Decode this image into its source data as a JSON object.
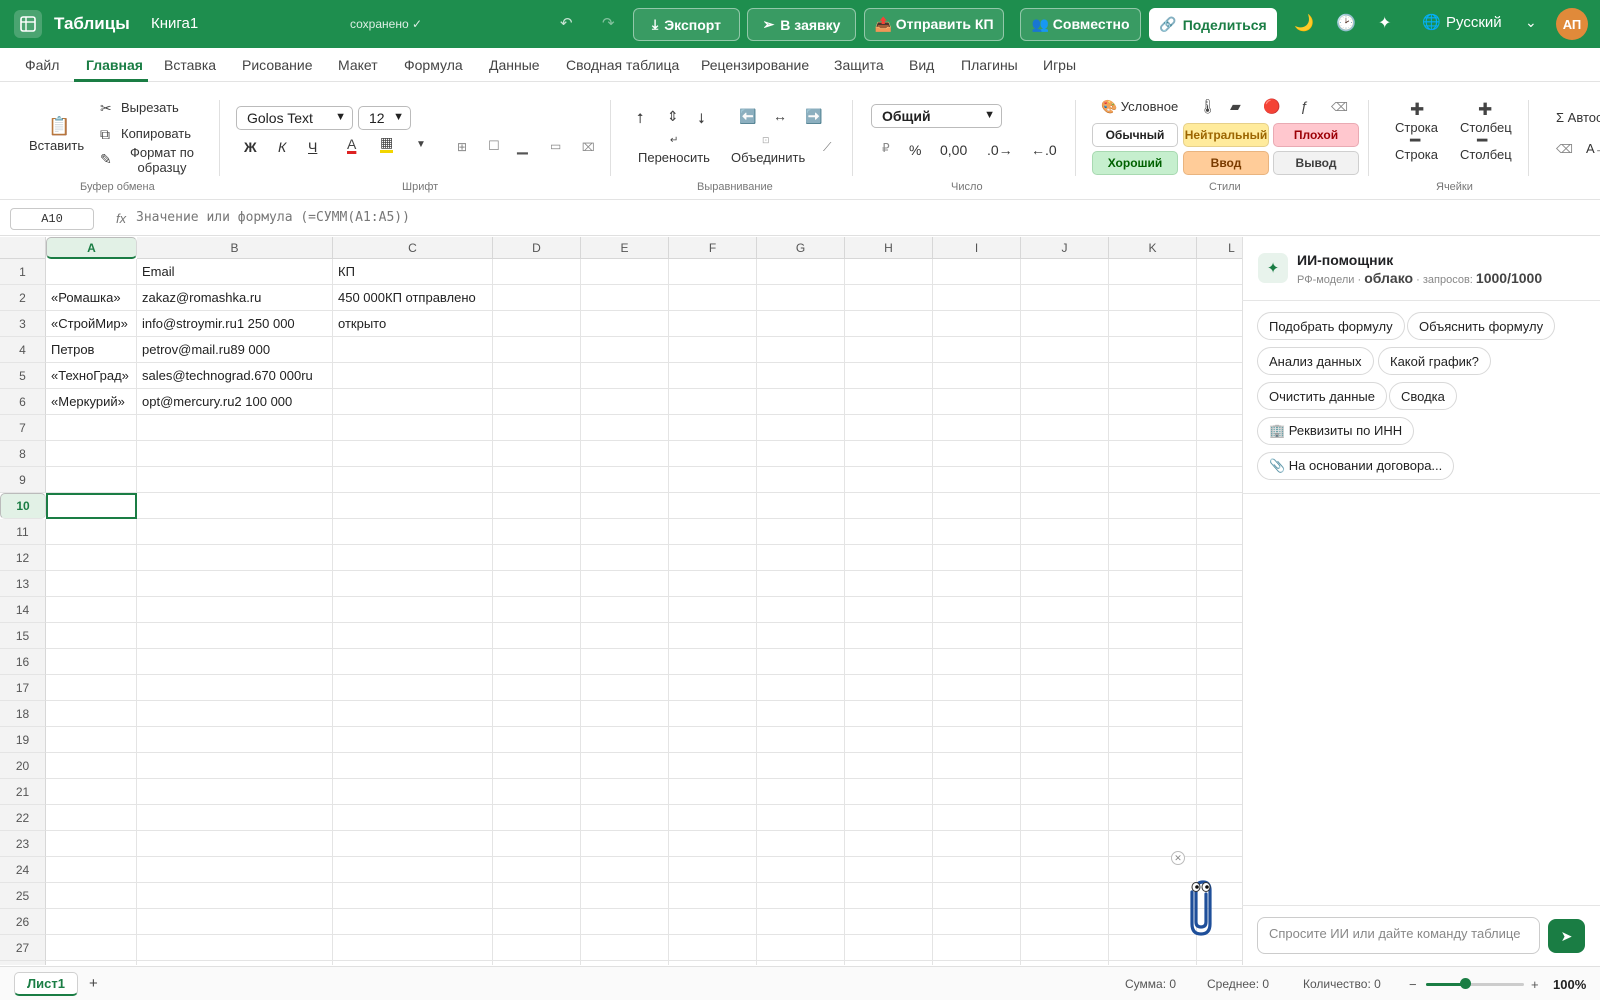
{
  "topbar": {
    "app_title": "Таблицы",
    "doc_title": "Книга1",
    "saved_status": "сохранено ✓",
    "export_label": "Экспорт",
    "to_request_label": "В заявку",
    "send_offer_label": "📤 Отправить КП",
    "collab_label": "👥 Совместно",
    "share_label": "Поделиться",
    "language": "Русский",
    "avatar_initials": "АП"
  },
  "menu": [
    "Файл",
    "Главная",
    "Вставка",
    "Рисование",
    "Макет",
    "Формула",
    "Данные",
    "Сводная таблица",
    "Рецензирование",
    "Защита",
    "Вид",
    "Плагины",
    "Игры"
  ],
  "ribbon": {
    "clipboard": {
      "paste": "Вставить",
      "cut": "Вырезать",
      "copy": "Копировать",
      "format_painter": "Формат по образцу",
      "group": "Буфер обмена"
    },
    "font": {
      "family": "Golos Text",
      "size": "12",
      "bold": "Ж",
      "italic": "К",
      "underline": "Ч",
      "group": "Шрифт"
    },
    "alignment": {
      "wrap": "Переносить",
      "merge": "Объединить",
      "group": "Выравнивание"
    },
    "number": {
      "format": "Общий",
      "percent": "%",
      "comma": "0,00",
      "inc": ".0→",
      "dec": "←.0",
      "group": "Число"
    },
    "styles": {
      "conditional": "🎨 Условное",
      "normal": "Обычный",
      "neutral": "Нейтральный",
      "bad": "Плохой",
      "good": "Хороший",
      "input": "Ввод",
      "output": "Вывод",
      "group": "Стили"
    },
    "cells": {
      "row_insert": "Строка",
      "col_insert": "Столбец",
      "row_delete": "Строка",
      "col_delete": "Столбец",
      "group": "Ячейки"
    },
    "editing": {
      "autosum": "Σ Автос",
      "clear": "A→"
    }
  },
  "formula_bar": {
    "cell_ref": "A10",
    "fx": "fx",
    "placeholder": "Значение или формула (=СУММ(A1:A5))"
  },
  "sheet": {
    "columns": [
      "A",
      "B",
      "C",
      "D",
      "E",
      "F",
      "G",
      "H",
      "I",
      "J",
      "K",
      "L"
    ],
    "selected_cell": "A10",
    "cells": [
      {
        "row": 1,
        "col": "B",
        "value": "Email"
      },
      {
        "row": 1,
        "col": "C",
        "value": "КП"
      },
      {
        "row": 2,
        "col": "A",
        "value": "«Ромашка»"
      },
      {
        "row": 2,
        "col": "B",
        "value": "zakaz@romashka.ru"
      },
      {
        "row": 2,
        "col": "C",
        "value": "450 000КП отправлено"
      },
      {
        "row": 3,
        "col": "A",
        "value": "«СтройМир»"
      },
      {
        "row": 3,
        "col": "B",
        "value": "info@stroymir.ru1 250 000"
      },
      {
        "row": 3,
        "col": "C",
        "value": "открыто"
      },
      {
        "row": 4,
        "col": "A",
        "value": "Петров"
      },
      {
        "row": 4,
        "col": "B",
        "value": "petrov@mail.ru89 000"
      },
      {
        "row": 5,
        "col": "A",
        "value": "«ТехноГрад»"
      },
      {
        "row": 5,
        "col": "B",
        "value": "sales@technograd.670 000ru"
      },
      {
        "row": 6,
        "col": "A",
        "value": "«Меркурий»"
      },
      {
        "row": 6,
        "col": "B",
        "value": "opt@mercury.ru2 100 000"
      }
    ]
  },
  "assistant": {
    "title": "ИИ-помощник",
    "subtitle_prefix": "РФ-модели · ",
    "mode": "облако",
    "requests_label": " · запросов: ",
    "requests": "1000/1000",
    "chips": [
      "Подобрать формулу",
      "Объяснить формулу",
      "Анализ данных",
      "Какой график?",
      "Очистить данные",
      "Сводка",
      "🏢 Реквизиты по ИНН",
      "📎 На основании договора..."
    ],
    "input_placeholder": "Спросите ИИ или дайте команду таблице"
  },
  "status": {
    "sheet_name": "Лист1",
    "add_sheet": "+",
    "sum": "Сумма: 0",
    "average": "Среднее: 0",
    "count": "Количество: 0",
    "zoom": "100%",
    "zoom_level": 0.4
  },
  "colors": {
    "brand": "#1e8e4e",
    "accent": "#1a7d44"
  }
}
